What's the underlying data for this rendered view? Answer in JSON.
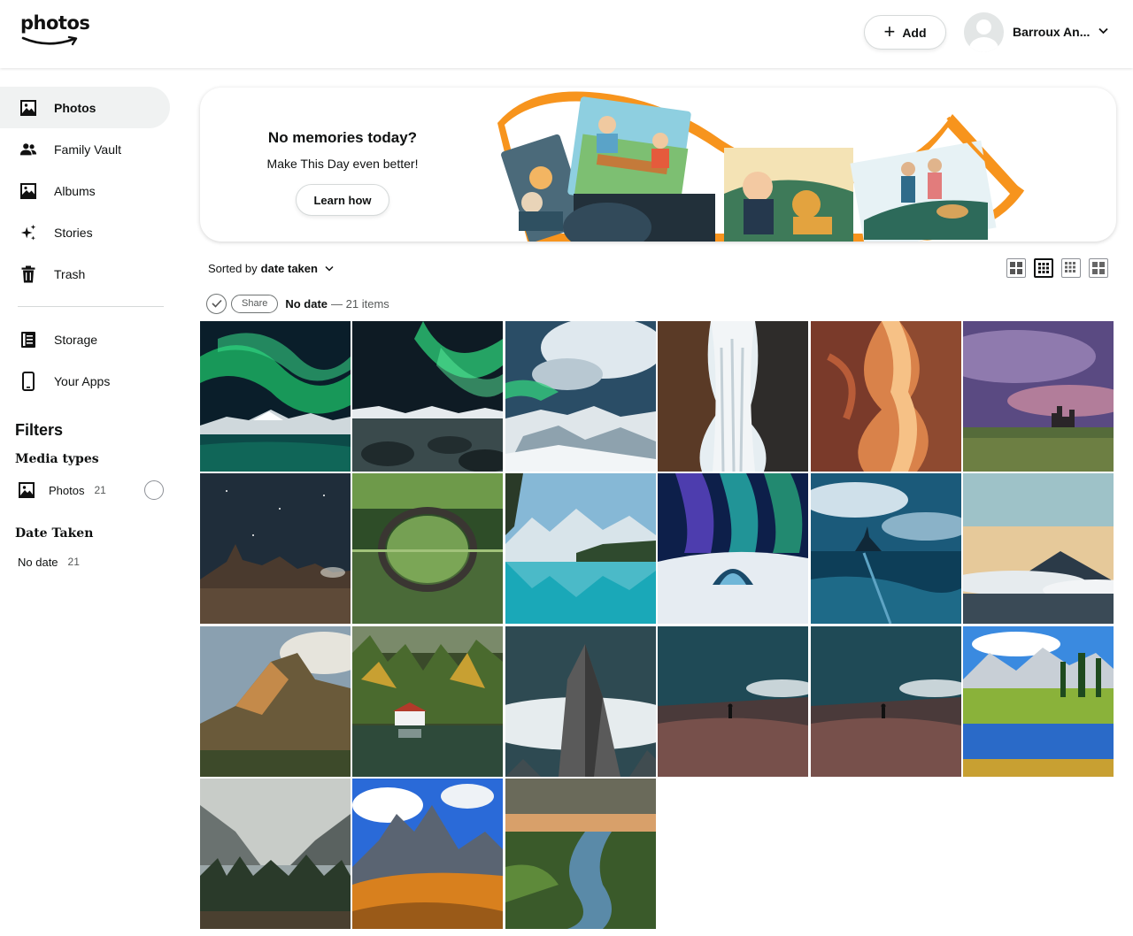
{
  "app": {
    "logo_text": "photos",
    "add_label": "Add",
    "user_name": "Barroux An..."
  },
  "sidebar": {
    "items": [
      {
        "label": "Photos",
        "icon": "photos-icon",
        "active": true
      },
      {
        "label": "Family Vault",
        "icon": "family-icon"
      },
      {
        "label": "Albums",
        "icon": "albums-icon"
      },
      {
        "label": "Stories",
        "icon": "sparkle-icon"
      },
      {
        "label": "Trash",
        "icon": "trash-icon"
      }
    ],
    "secondary": [
      {
        "label": "Storage",
        "icon": "storage-icon"
      },
      {
        "label": "Your Apps",
        "icon": "phone-icon"
      }
    ],
    "filters_title": "Filters",
    "media_types_title": "Media types",
    "media_photos_label": "Photos",
    "media_photos_count": "21",
    "date_taken_title": "Date Taken",
    "no_date_label": "No date",
    "no_date_count": "21"
  },
  "banner": {
    "title": "No memories today?",
    "subtitle": "Make This Day even better!",
    "button": "Learn how"
  },
  "toolbar": {
    "sort_prefix": "Sorted by",
    "sort_value": "date taken"
  },
  "group": {
    "share_label": "Share",
    "date_label": "No date",
    "count_label": "— 21 items"
  },
  "colors": {
    "accent_orange": "#f7941d",
    "active_nav_bg": "#f0f2f2",
    "text": "#0f1111",
    "muted": "#565959"
  },
  "photos": [
    {
      "name": "aurora-lake"
    },
    {
      "name": "aurora-rocky-shore"
    },
    {
      "name": "aurora-snowy-mountains"
    },
    {
      "name": "waterfall-cliffs"
    },
    {
      "name": "antelope-canyon"
    },
    {
      "name": "castle-purple-sky"
    },
    {
      "name": "desert-rocks-night"
    },
    {
      "name": "arch-bridge-reflection"
    },
    {
      "name": "turquoise-mountain-lake"
    },
    {
      "name": "aurora-ice-cave"
    },
    {
      "name": "mont-saint-michel"
    },
    {
      "name": "volcano-above-clouds"
    },
    {
      "name": "coastal-mountain-ridge"
    },
    {
      "name": "lakeside-house-autumn"
    },
    {
      "name": "rock-spire-fog"
    },
    {
      "name": "person-tidal-flat"
    },
    {
      "name": "person-tidal-flat-2"
    },
    {
      "name": "alpine-meadow-lake"
    },
    {
      "name": "misty-valley-lake"
    },
    {
      "name": "dolomites-peaks"
    },
    {
      "name": "river-sunset"
    }
  ]
}
